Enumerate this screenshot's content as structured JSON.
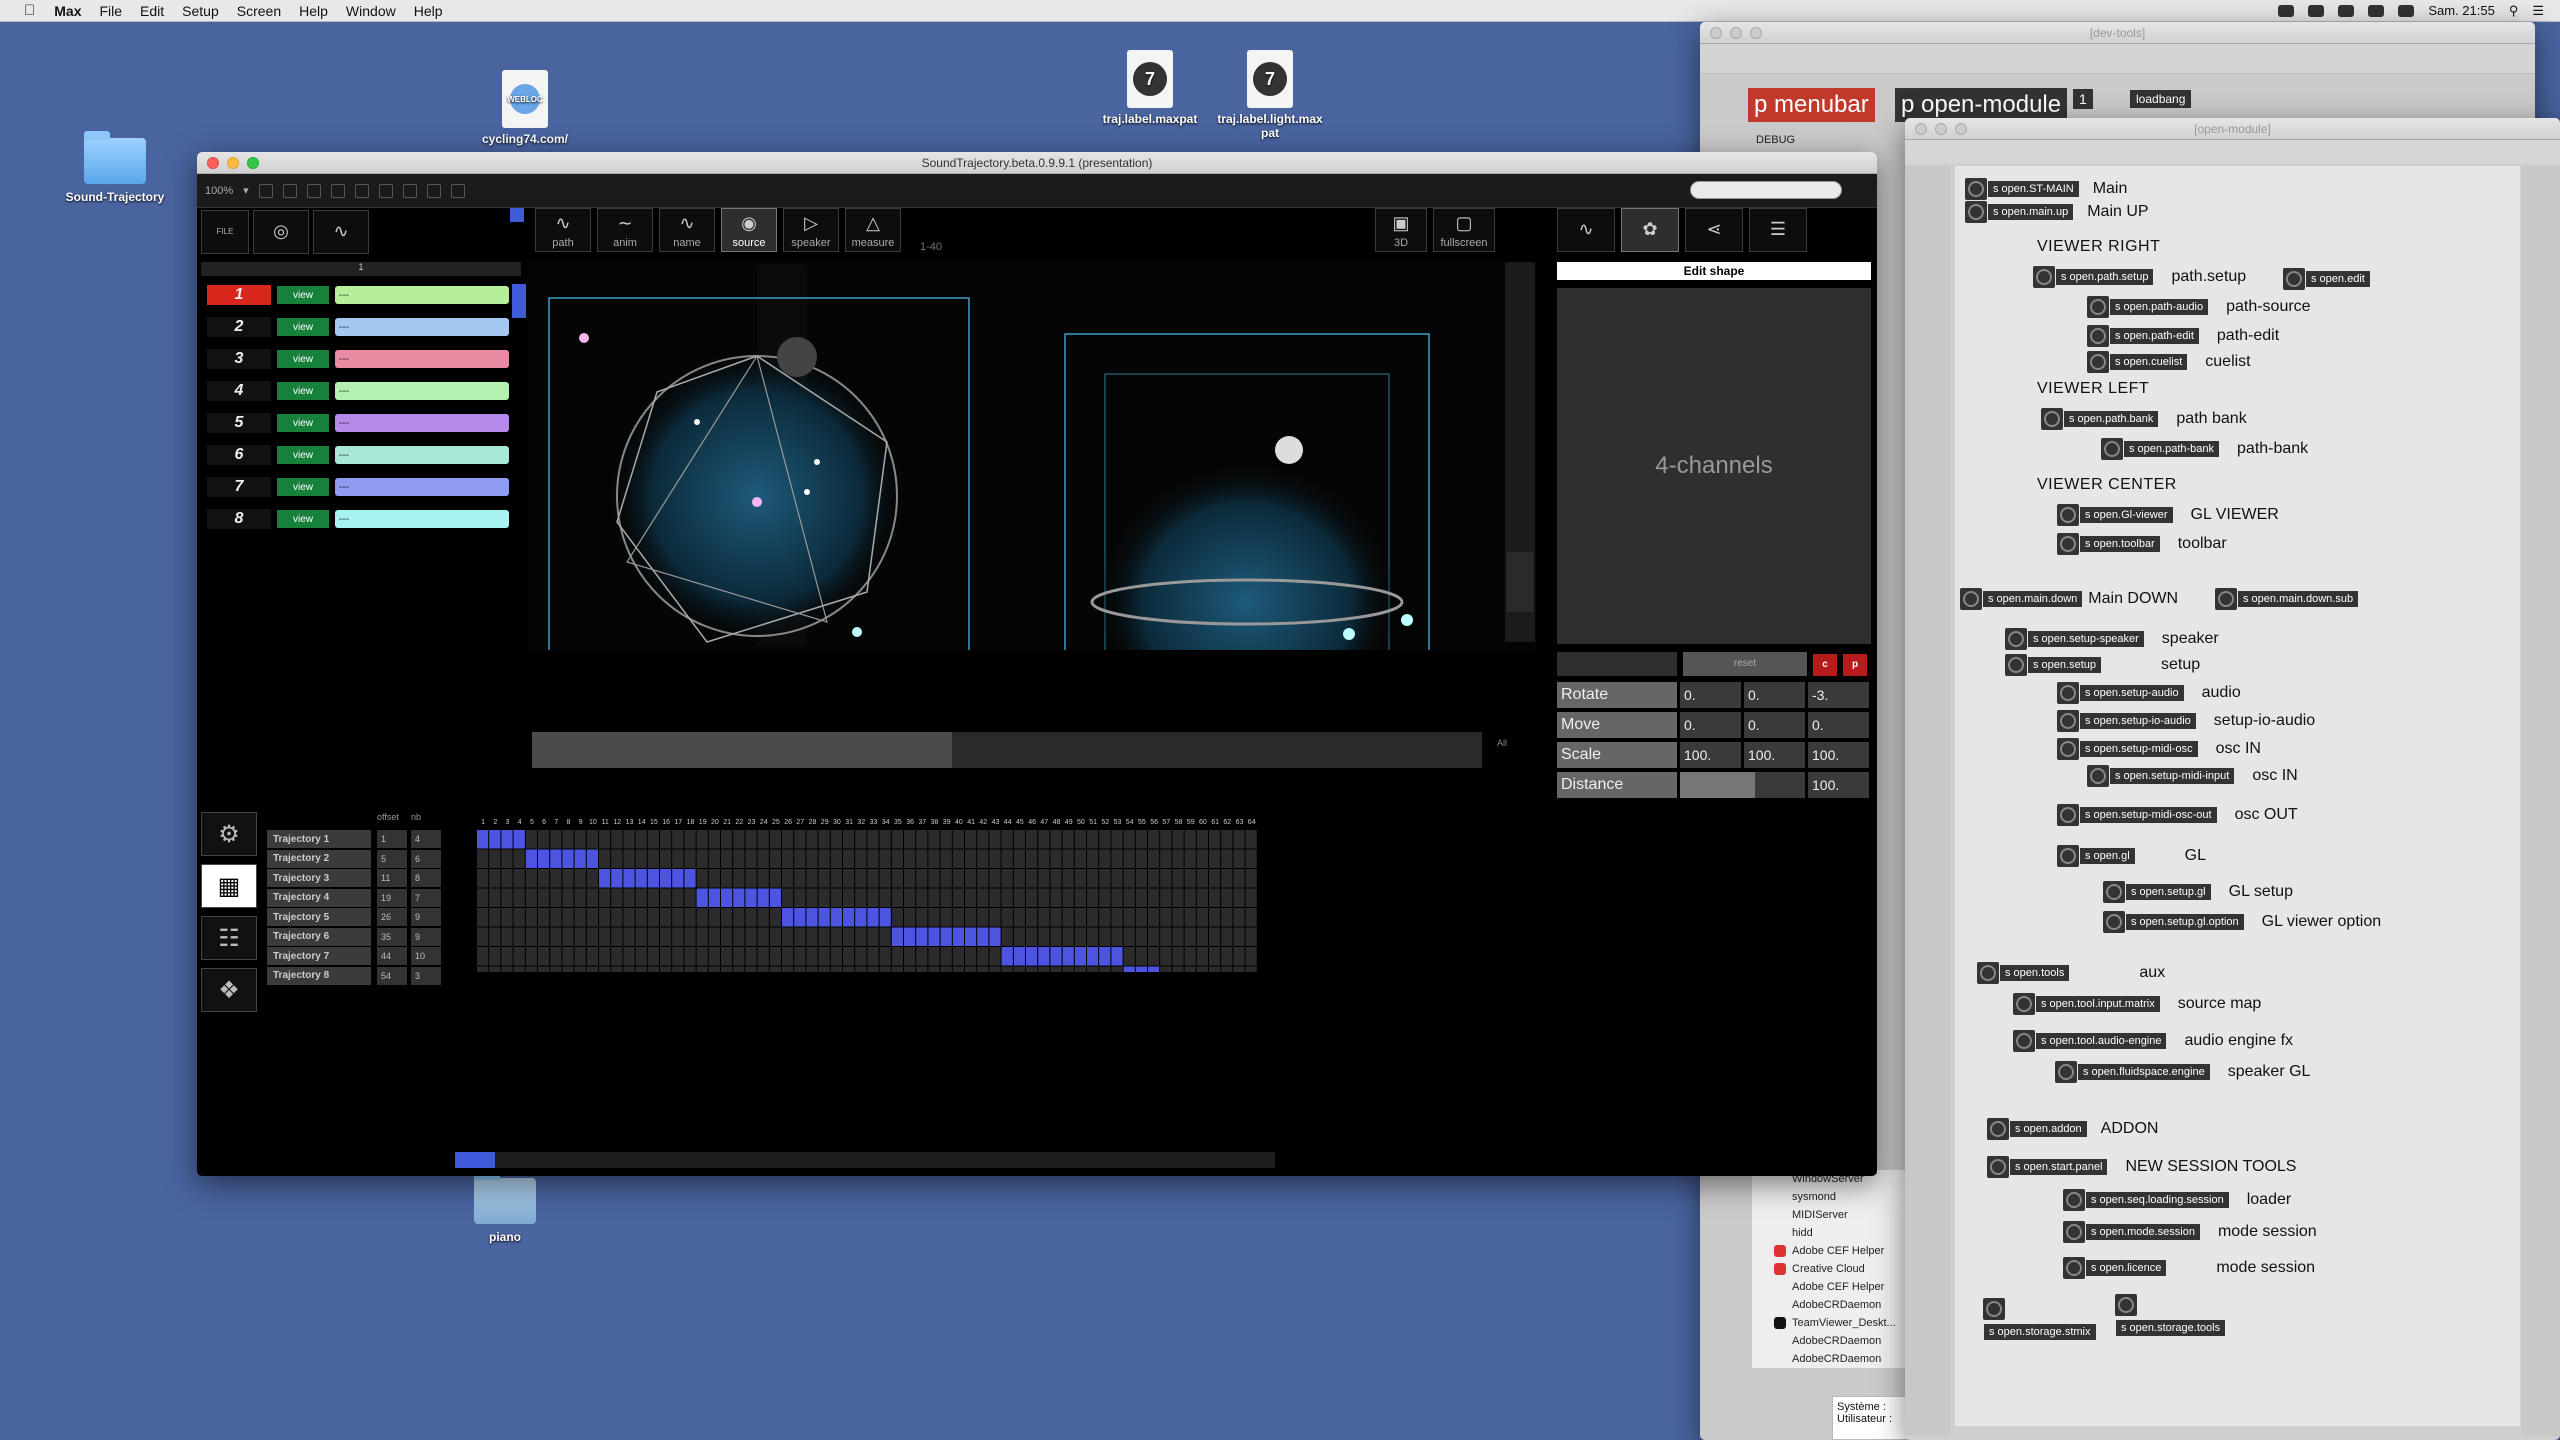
{
  "menubar": {
    "app": "Max",
    "items": [
      "File",
      "Edit",
      "Setup",
      "Screen",
      "Help",
      "Window",
      "Help"
    ],
    "clock": "Sam. 21:55"
  },
  "desktop": {
    "icons": [
      {
        "label": "Sound-Trajectory"
      },
      {
        "label": "cycling74.com/",
        "badge": "WEBLOC"
      },
      {
        "label": "traj.label.maxpat"
      },
      {
        "label": "traj.label.light.max pat"
      },
      {
        "label": "piano"
      }
    ]
  },
  "devtools": {
    "title": "[dev-tools]",
    "menubar_label": "p menubar",
    "open_module_label": "p open-module",
    "loadbang": "loadbang",
    "number": "1",
    "debug": "DEBUG",
    "system": "Système :",
    "user": "Utilisateur :",
    "processes": [
      "WindowServer",
      "sysmond",
      "MIDIServer",
      "hidd",
      "Adobe CEF Helper",
      "Creative Cloud",
      "Adobe CEF Helper",
      "AdobeCRDaemon",
      "TeamViewer_Deskt...",
      "AdobeCRDaemon",
      "AdobeCRDaemon"
    ]
  },
  "open_module": {
    "title": "[open-module]",
    "sections": {
      "viewer_right": "VIEWER  RIGHT",
      "viewer_left": "VIEWER  LEFT",
      "viewer_center": "VIEWER  CENTER"
    },
    "nodes": [
      {
        "s": "s open.ST-MAIN",
        "label": "Main"
      },
      {
        "s": "s open.main.up",
        "label": "Main UP"
      },
      {
        "s": "s open.path.setup",
        "label": "path.setup"
      },
      {
        "s": "s open.edit",
        "label": ""
      },
      {
        "s": "s open.path-audio",
        "label": "path-source"
      },
      {
        "s": "s open.path-edit",
        "label": "path-edit"
      },
      {
        "s": "s open.cuelist",
        "label": "cuelist"
      },
      {
        "s": "s open.path.bank",
        "label": "path bank"
      },
      {
        "s": "s open.path-bank",
        "label": "path-bank"
      },
      {
        "s": "s open.Gl-viewer",
        "label": "GL VIEWER"
      },
      {
        "s": "s open.toolbar",
        "label": "toolbar"
      },
      {
        "s": "s open.main.down",
        "label": "Main  DOWN"
      },
      {
        "s": "s open.main.down.sub",
        "label": ""
      },
      {
        "s": "s open.setup-speaker",
        "label": "speaker"
      },
      {
        "s": "s open.setup",
        "label": "setup"
      },
      {
        "s": "s open.setup-audio",
        "label": "audio"
      },
      {
        "s": "s open.setup-io-audio",
        "label": "setup-io-audio"
      },
      {
        "s": "s open.setup-midi-osc",
        "label": "osc IN"
      },
      {
        "s": "s open.setup-midi-input",
        "label": "osc IN"
      },
      {
        "s": "s open.setup-midi-osc-out",
        "label": "osc OUT"
      },
      {
        "s": "s open.gl",
        "label": "GL"
      },
      {
        "s": "s open.setup.gl",
        "label": "GL setup"
      },
      {
        "s": "s open.setup.gl.option",
        "label": "GL viewer option"
      },
      {
        "s": "s open.tools",
        "label": "aux"
      },
      {
        "s": "s open.tool.input.matrix",
        "label": "source map"
      },
      {
        "s": "s open.tool.audio-engine",
        "label": "audio engine fx"
      },
      {
        "s": "s open.fluidspace.engine",
        "label": "speaker GL"
      },
      {
        "s": "s open.addon",
        "label": "ADDON"
      },
      {
        "s": "s open.start.panel",
        "label": "NEW SESSION TOOLS"
      },
      {
        "s": "s open.seq.loading.session",
        "label": "loader"
      },
      {
        "s": "s open.mode.session",
        "label": "mode session"
      },
      {
        "s": "s open.licence",
        "label": "mode session"
      },
      {
        "s": "s open.storage.stmix",
        "label": ""
      },
      {
        "s": "s open.storage.tools",
        "label": ""
      }
    ]
  },
  "main_window": {
    "title": "SoundTrajectory.beta.0.9.9.1 (presentation)",
    "zoom": "100%",
    "toolbar_left": [
      "FILE",
      "",
      ""
    ],
    "tools": [
      {
        "label": "path"
      },
      {
        "label": "anim"
      },
      {
        "label": "name"
      },
      {
        "label": "source"
      },
      {
        "label": "speaker"
      },
      {
        "label": "measure"
      }
    ],
    "range_label": "1-40",
    "view_buttons": [
      {
        "label": "3D"
      },
      {
        "label": "fullscreen"
      }
    ],
    "list_header": "1",
    "tracks": [
      {
        "n": "1",
        "color": "#b6ef9a"
      },
      {
        "n": "2",
        "color": "#a5c8f2"
      },
      {
        "n": "3",
        "color": "#e88aa2"
      },
      {
        "n": "4",
        "color": "#b4f0b0"
      },
      {
        "n": "5",
        "color": "#b68ae8"
      },
      {
        "n": "6",
        "color": "#a7e8d8"
      },
      {
        "n": "7",
        "color": "#8f9cf0"
      },
      {
        "n": "8",
        "color": "#a8f2f2"
      }
    ],
    "view_label": "view",
    "dash": "---",
    "all_label": "All",
    "edit_shape": "Edit shape",
    "shape_name": "4-channels",
    "reset": "reset",
    "c": "c",
    "p": "p",
    "transforms": [
      {
        "name": "Rotate",
        "v": [
          "0.",
          "0.",
          "-3."
        ]
      },
      {
        "name": "Move",
        "v": [
          "0.",
          "0.",
          "0."
        ]
      },
      {
        "name": "Scale",
        "v": [
          "100.",
          "100.",
          "100."
        ]
      },
      {
        "name": "Distance",
        "v": [
          "",
          "",
          "100."
        ]
      }
    ],
    "grid": {
      "offset_label": "offset",
      "nb_label": "nb",
      "columns": 64,
      "rows": [
        {
          "name": "Trajectory 1",
          "offset": "1",
          "nb": "4"
        },
        {
          "name": "Trajectory 2",
          "offset": "5",
          "nb": "6"
        },
        {
          "name": "Trajectory 3",
          "offset": "11",
          "nb": "8"
        },
        {
          "name": "Trajectory 4",
          "offset": "19",
          "nb": "7"
        },
        {
          "name": "Trajectory 5",
          "offset": "26",
          "nb": "9"
        },
        {
          "name": "Trajectory 6",
          "offset": "35",
          "nb": "9"
        },
        {
          "name": "Trajectory 7",
          "offset": "44",
          "nb": "10"
        },
        {
          "name": "Trajectory 8",
          "offset": "54",
          "nb": "3"
        }
      ]
    },
    "colors": {
      "accent": "#4d55e0",
      "red": "#d9261c",
      "green": "#17803a"
    }
  }
}
